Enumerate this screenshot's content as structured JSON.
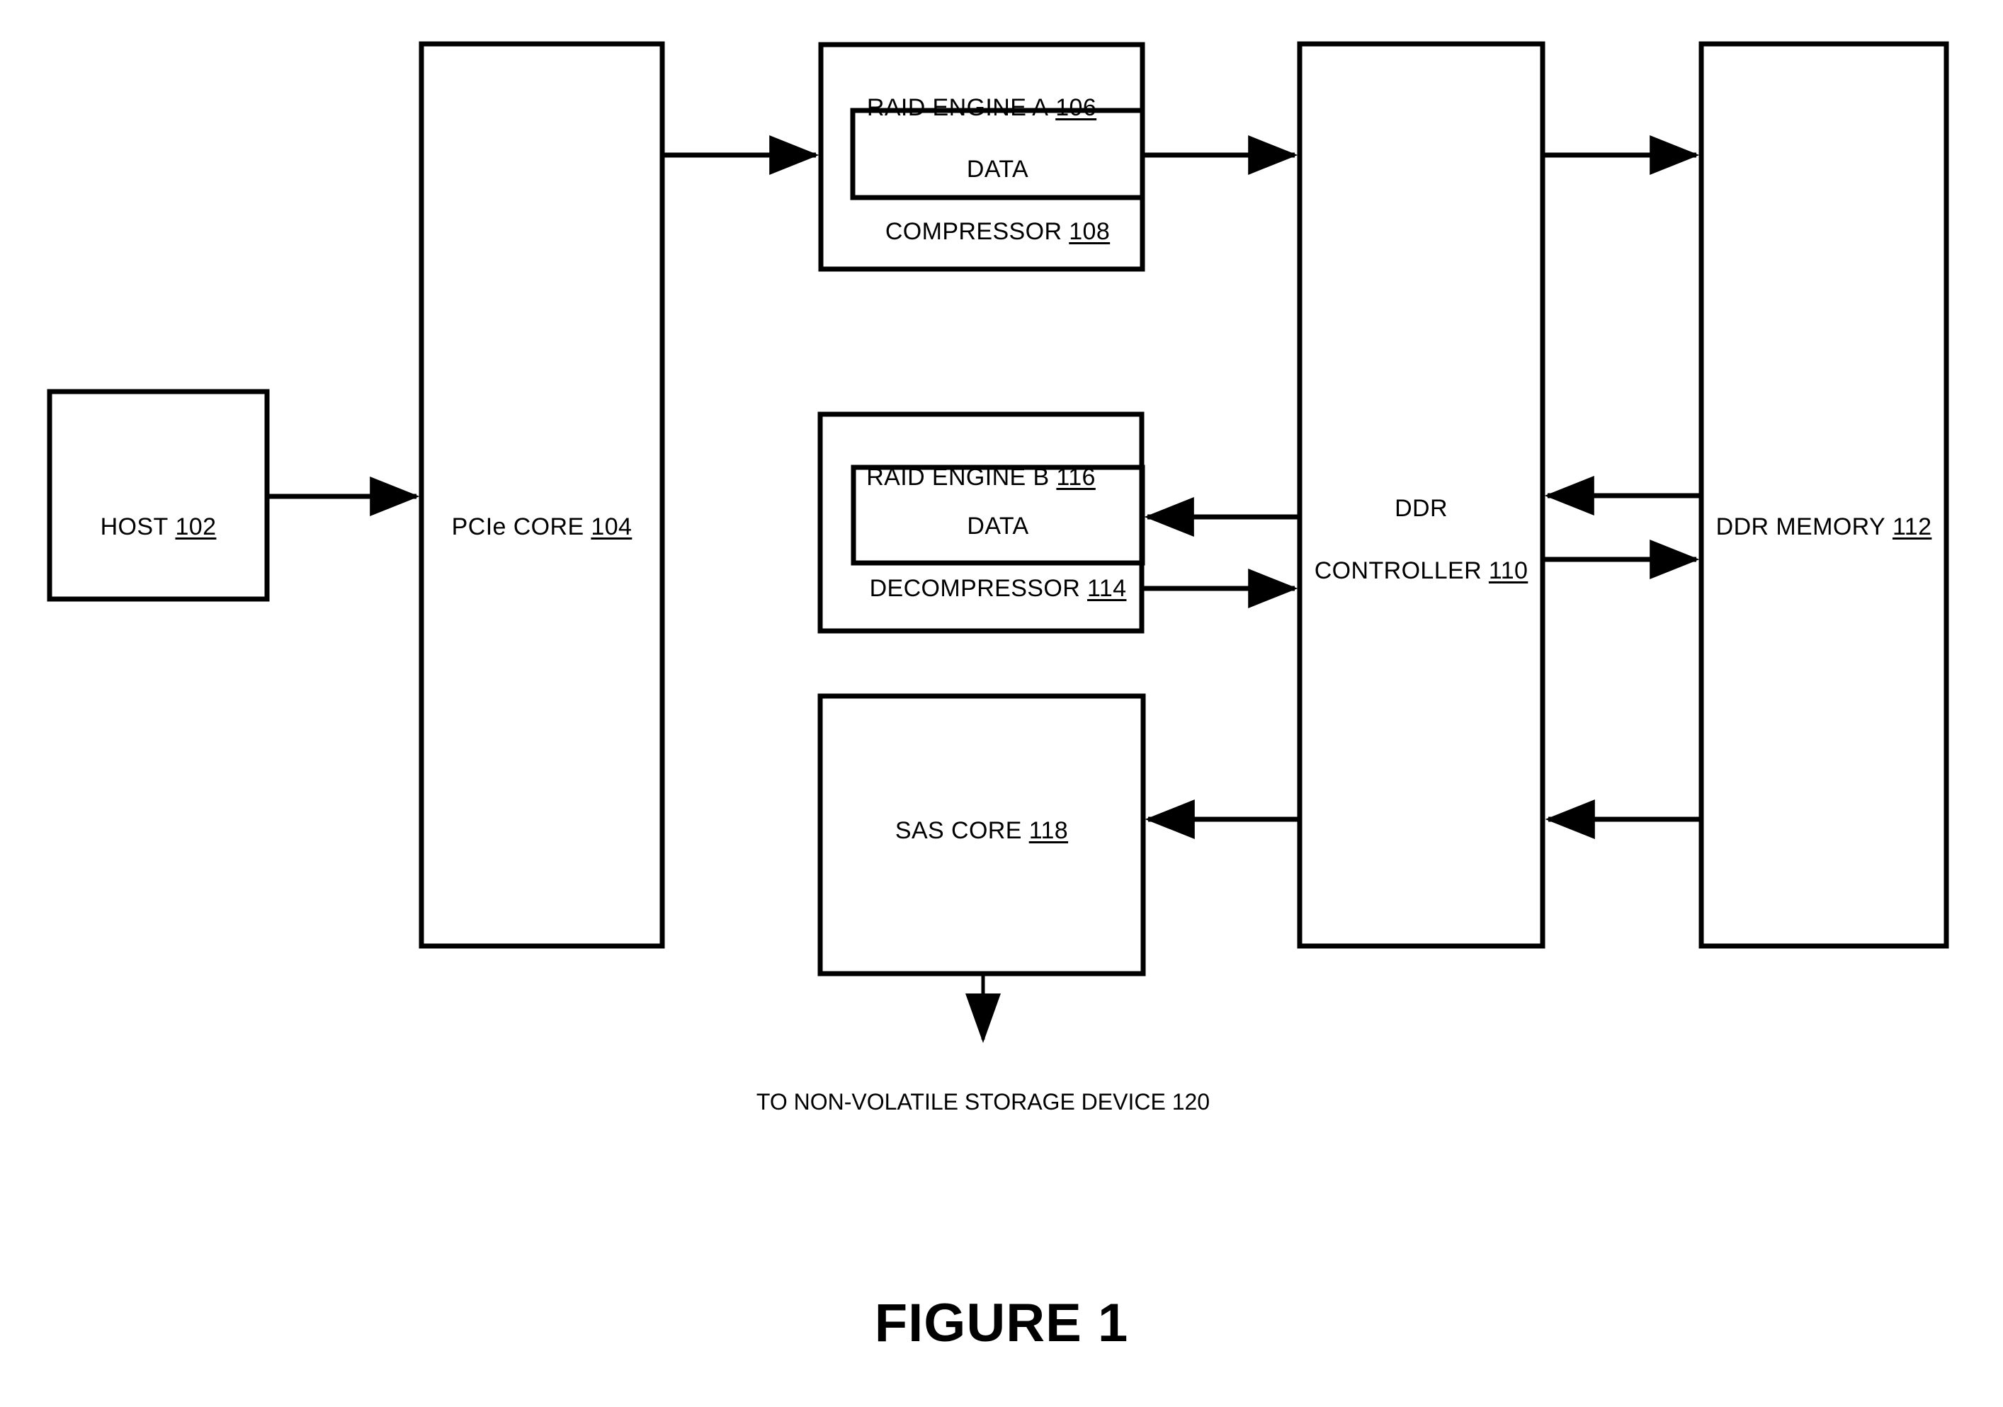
{
  "figure": {
    "caption": "FIGURE 1",
    "sheet_background": "#ffffff",
    "ink_color": "#000000"
  },
  "blocks": {
    "host": {
      "name": "HOST",
      "ref": "102",
      "label": "HOST 102"
    },
    "pcie_core": {
      "name": "PCIe CORE",
      "ref": "104",
      "label": "PCIe CORE 104"
    },
    "raid_engine_a": {
      "name": "RAID ENGINE A",
      "ref": "106",
      "label": "RAID ENGINE A 106"
    },
    "data_compressor": {
      "name": "DATA COMPRESSOR",
      "ref": "108",
      "line1": "DATA",
      "line2": "COMPRESSOR 108"
    },
    "raid_engine_b": {
      "name": "RAID ENGINE B",
      "ref": "116",
      "label": "RAID ENGINE B 116"
    },
    "data_decompressor": {
      "name": "DATA DECOMPRESSOR",
      "ref": "114",
      "line1": "DATA",
      "line2": "DECOMPRESSOR 114"
    },
    "sas_core": {
      "name": "SAS CORE",
      "ref": "118",
      "label": "SAS CORE 118"
    },
    "ddr_controller": {
      "name": "DDR CONTROLLER",
      "ref": "110",
      "line1": "DDR",
      "line2": "CONTROLLER 110"
    },
    "ddr_memory": {
      "name": "DDR MEMORY",
      "ref": "112",
      "label": "DDR MEMORY 112"
    }
  },
  "annotations": {
    "storage_device": {
      "text": "TO NON-VOLATILE STORAGE DEVICE 120",
      "ref": "120"
    }
  },
  "connections": [
    {
      "id": "host-to-pcie",
      "from": "HOST 102",
      "to": "PCIe CORE 104",
      "direction": "right"
    },
    {
      "id": "pcie-to-raid-a",
      "from": "PCIe CORE 104",
      "to": "RAID ENGINE A 106",
      "direction": "right"
    },
    {
      "id": "raid-a-to-ddr-controller",
      "from": "RAID ENGINE A 106",
      "to": "DDR CONTROLLER 110",
      "direction": "right"
    },
    {
      "id": "ddr-controller-to-ddr-memory-top",
      "from": "DDR CONTROLLER 110",
      "to": "DDR MEMORY 112",
      "direction": "right"
    },
    {
      "id": "ddr-memory-to-ddr-controller",
      "from": "DDR MEMORY 112",
      "to": "DDR CONTROLLER 110",
      "direction": "left"
    },
    {
      "id": "ddr-controller-to-raid-b",
      "from": "DDR CONTROLLER 110",
      "to": "DATA DECOMPRESSOR 114",
      "direction": "left"
    },
    {
      "id": "raid-b-to-ddr-controller",
      "from": "RAID ENGINE B 116",
      "to": "DDR CONTROLLER 110",
      "direction": "right"
    },
    {
      "id": "ddr-controller-to-ddr-memory-mid",
      "from": "DDR CONTROLLER 110",
      "to": "DDR MEMORY 112",
      "direction": "right"
    },
    {
      "id": "ddr-controller-to-sas-core",
      "from": "DDR CONTROLLER 110",
      "to": "SAS CORE 118",
      "direction": "left"
    },
    {
      "id": "ddr-memory-to-ddr-controller-low",
      "from": "DDR MEMORY 112",
      "to": "DDR CONTROLLER 110",
      "direction": "left"
    },
    {
      "id": "sas-core-to-storage",
      "from": "SAS CORE 118",
      "to": "TO NON-VOLATILE STORAGE DEVICE 120",
      "direction": "down"
    }
  ]
}
